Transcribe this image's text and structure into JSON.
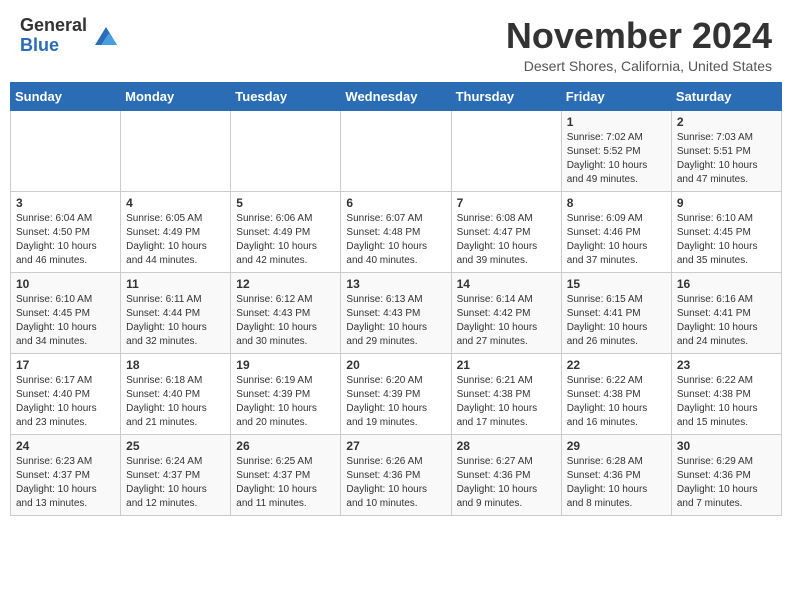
{
  "logo": {
    "general": "General",
    "blue": "Blue"
  },
  "title": "November 2024",
  "subtitle": "Desert Shores, California, United States",
  "days_of_week": [
    "Sunday",
    "Monday",
    "Tuesday",
    "Wednesday",
    "Thursday",
    "Friday",
    "Saturday"
  ],
  "weeks": [
    [
      {
        "day": "",
        "info": ""
      },
      {
        "day": "",
        "info": ""
      },
      {
        "day": "",
        "info": ""
      },
      {
        "day": "",
        "info": ""
      },
      {
        "day": "",
        "info": ""
      },
      {
        "day": "1",
        "info": "Sunrise: 7:02 AM\nSunset: 5:52 PM\nDaylight: 10 hours and 49 minutes."
      },
      {
        "day": "2",
        "info": "Sunrise: 7:03 AM\nSunset: 5:51 PM\nDaylight: 10 hours and 47 minutes."
      }
    ],
    [
      {
        "day": "3",
        "info": "Sunrise: 6:04 AM\nSunset: 4:50 PM\nDaylight: 10 hours and 46 minutes."
      },
      {
        "day": "4",
        "info": "Sunrise: 6:05 AM\nSunset: 4:49 PM\nDaylight: 10 hours and 44 minutes."
      },
      {
        "day": "5",
        "info": "Sunrise: 6:06 AM\nSunset: 4:49 PM\nDaylight: 10 hours and 42 minutes."
      },
      {
        "day": "6",
        "info": "Sunrise: 6:07 AM\nSunset: 4:48 PM\nDaylight: 10 hours and 40 minutes."
      },
      {
        "day": "7",
        "info": "Sunrise: 6:08 AM\nSunset: 4:47 PM\nDaylight: 10 hours and 39 minutes."
      },
      {
        "day": "8",
        "info": "Sunrise: 6:09 AM\nSunset: 4:46 PM\nDaylight: 10 hours and 37 minutes."
      },
      {
        "day": "9",
        "info": "Sunrise: 6:10 AM\nSunset: 4:45 PM\nDaylight: 10 hours and 35 minutes."
      }
    ],
    [
      {
        "day": "10",
        "info": "Sunrise: 6:10 AM\nSunset: 4:45 PM\nDaylight: 10 hours and 34 minutes."
      },
      {
        "day": "11",
        "info": "Sunrise: 6:11 AM\nSunset: 4:44 PM\nDaylight: 10 hours and 32 minutes."
      },
      {
        "day": "12",
        "info": "Sunrise: 6:12 AM\nSunset: 4:43 PM\nDaylight: 10 hours and 30 minutes."
      },
      {
        "day": "13",
        "info": "Sunrise: 6:13 AM\nSunset: 4:43 PM\nDaylight: 10 hours and 29 minutes."
      },
      {
        "day": "14",
        "info": "Sunrise: 6:14 AM\nSunset: 4:42 PM\nDaylight: 10 hours and 27 minutes."
      },
      {
        "day": "15",
        "info": "Sunrise: 6:15 AM\nSunset: 4:41 PM\nDaylight: 10 hours and 26 minutes."
      },
      {
        "day": "16",
        "info": "Sunrise: 6:16 AM\nSunset: 4:41 PM\nDaylight: 10 hours and 24 minutes."
      }
    ],
    [
      {
        "day": "17",
        "info": "Sunrise: 6:17 AM\nSunset: 4:40 PM\nDaylight: 10 hours and 23 minutes."
      },
      {
        "day": "18",
        "info": "Sunrise: 6:18 AM\nSunset: 4:40 PM\nDaylight: 10 hours and 21 minutes."
      },
      {
        "day": "19",
        "info": "Sunrise: 6:19 AM\nSunset: 4:39 PM\nDaylight: 10 hours and 20 minutes."
      },
      {
        "day": "20",
        "info": "Sunrise: 6:20 AM\nSunset: 4:39 PM\nDaylight: 10 hours and 19 minutes."
      },
      {
        "day": "21",
        "info": "Sunrise: 6:21 AM\nSunset: 4:38 PM\nDaylight: 10 hours and 17 minutes."
      },
      {
        "day": "22",
        "info": "Sunrise: 6:22 AM\nSunset: 4:38 PM\nDaylight: 10 hours and 16 minutes."
      },
      {
        "day": "23",
        "info": "Sunrise: 6:22 AM\nSunset: 4:38 PM\nDaylight: 10 hours and 15 minutes."
      }
    ],
    [
      {
        "day": "24",
        "info": "Sunrise: 6:23 AM\nSunset: 4:37 PM\nDaylight: 10 hours and 13 minutes."
      },
      {
        "day": "25",
        "info": "Sunrise: 6:24 AM\nSunset: 4:37 PM\nDaylight: 10 hours and 12 minutes."
      },
      {
        "day": "26",
        "info": "Sunrise: 6:25 AM\nSunset: 4:37 PM\nDaylight: 10 hours and 11 minutes."
      },
      {
        "day": "27",
        "info": "Sunrise: 6:26 AM\nSunset: 4:36 PM\nDaylight: 10 hours and 10 minutes."
      },
      {
        "day": "28",
        "info": "Sunrise: 6:27 AM\nSunset: 4:36 PM\nDaylight: 10 hours and 9 minutes."
      },
      {
        "day": "29",
        "info": "Sunrise: 6:28 AM\nSunset: 4:36 PM\nDaylight: 10 hours and 8 minutes."
      },
      {
        "day": "30",
        "info": "Sunrise: 6:29 AM\nSunset: 4:36 PM\nDaylight: 10 hours and 7 minutes."
      }
    ]
  ]
}
